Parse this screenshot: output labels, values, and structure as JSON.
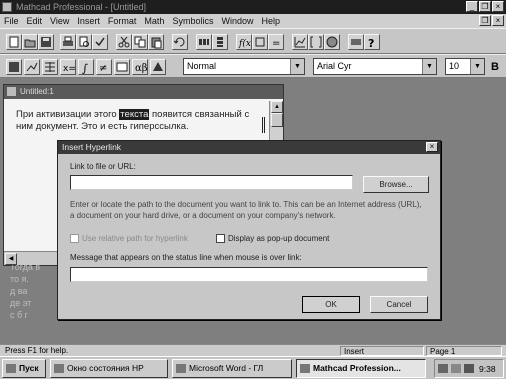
{
  "window": {
    "title": "Mathcad Professional - [Untitled]"
  },
  "menu": [
    "File",
    "Edit",
    "View",
    "Insert",
    "Format",
    "Math",
    "Symbolics",
    "Window",
    "Help"
  ],
  "toolbar": {
    "style_value": "Normal",
    "font_value": "Arial Cyr",
    "size_value": "10",
    "bold_label": "B"
  },
  "document": {
    "title": "Untitled:1",
    "text_before": "При активизации этого",
    "text_highlight": "текста",
    "text_after": "появится связанный с ним документ. Это и есть гипер­ссылка.",
    "faint_text": "Тогда в\nто я.\nд ва\nде эт\nс б г"
  },
  "dialog": {
    "title": "Insert Hyperlink",
    "link_label": "Link to file or URL:",
    "link_value": "",
    "browse_label": "Browse...",
    "instructions": "Enter or locate the path to the document you want to link to. This can be an Internet address (URL), a document on your hard drive, or a document on your company's network.",
    "relative_label": "Use relative path for hyperlink",
    "popup_label": "Display as pop-up document",
    "message_label": "Message that appears on the status line when mouse is over link:",
    "message_value": "",
    "ok_label": "OK",
    "cancel_label": "Cancel"
  },
  "statusbar": {
    "mode": "Press F1 for help.",
    "edit_mode": "Insert",
    "page": "Page 1"
  },
  "taskbar": {
    "start_label": "Пуск",
    "tasks": [
      "Окно состояния HP",
      "Microsoft Word - ГЛ",
      "Mathcad Profession..."
    ],
    "clock": "9:38"
  }
}
